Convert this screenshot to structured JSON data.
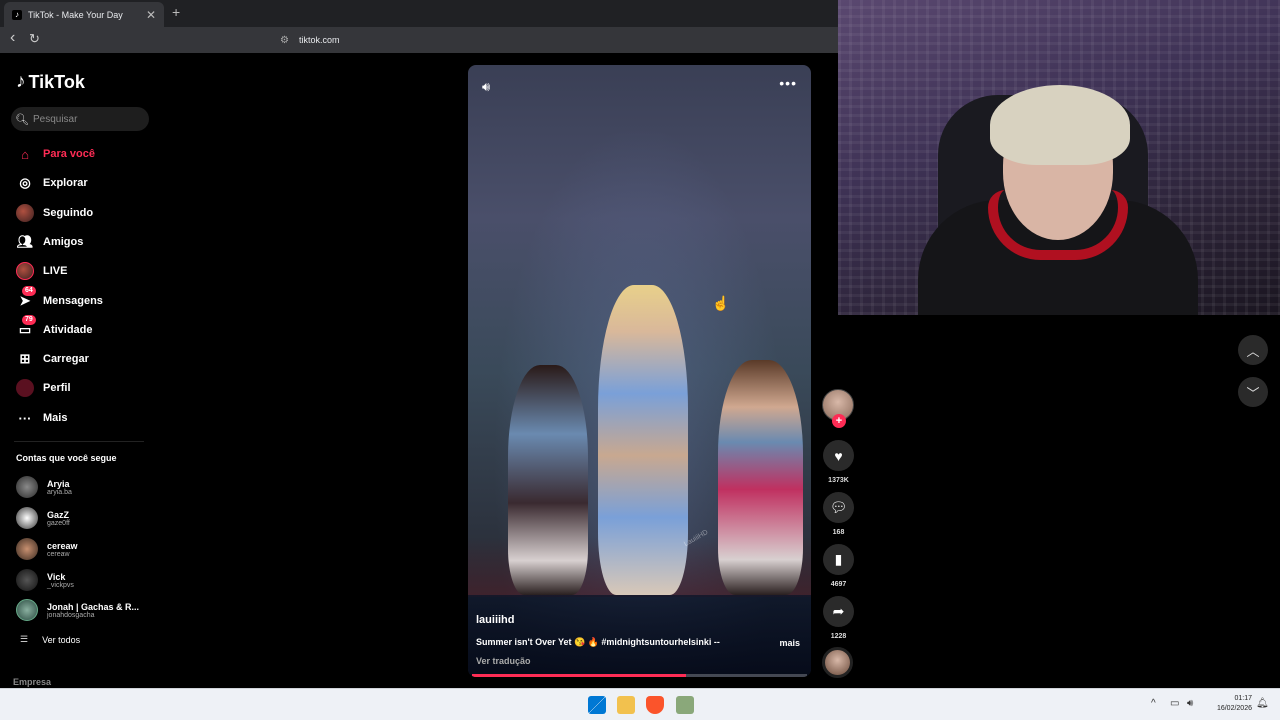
{
  "browser": {
    "tab_title": "TikTok - Make Your Day",
    "tab_close": "✕",
    "new_tab": "+",
    "back": "‹",
    "reload": "↻",
    "url": "tiktok.com"
  },
  "sidebar": {
    "logo": "TikTok",
    "search_placeholder": "Pesquisar",
    "nav": [
      {
        "label": "Para você",
        "icon": "home-icon",
        "active": true
      },
      {
        "label": "Explorar",
        "icon": "compass-icon"
      },
      {
        "label": "Seguindo",
        "icon": "following-avatar-icon"
      },
      {
        "label": "Amigos",
        "icon": "friends-icon"
      },
      {
        "label": "LIVE",
        "icon": "live-avatar-icon"
      },
      {
        "label": "Mensagens",
        "icon": "messages-icon",
        "badge": "64"
      },
      {
        "label": "Atividade",
        "icon": "activity-icon",
        "badge": "79"
      },
      {
        "label": "Carregar",
        "icon": "upload-icon"
      },
      {
        "label": "Perfil",
        "icon": "profile-avatar-icon"
      },
      {
        "label": "Mais",
        "icon": "more-dots-icon"
      }
    ],
    "following_title": "Contas que você segue",
    "accounts": [
      {
        "name": "Aryia",
        "handle": "aryia.ba"
      },
      {
        "name": "GazZ",
        "handle": "gaze0ff"
      },
      {
        "name": "cereaw",
        "handle": "cereaw"
      },
      {
        "name": "Vick",
        "handle": "_vickpvs"
      },
      {
        "name": "Jonah | Gachas & R...",
        "handle": "jonahdosgacha"
      }
    ],
    "see_all": "Ver todos",
    "footer": "Empresa"
  },
  "video": {
    "author": "lauiiihd",
    "caption": "Summer isn't Over Yet 😘 🔥 #midnightsuntourhelsinki --",
    "caption_more": "mais",
    "translate": "Ver tradução",
    "watermark": "LauiiiHD",
    "progress": 0.64
  },
  "actions": {
    "likes": "1373K",
    "comments": "168",
    "saves": "4697",
    "shares": "1228"
  },
  "taskbar": {
    "time": "01:17",
    "date": "16/02/2026"
  },
  "colors": {
    "accent": "#fe2c55",
    "sidebar_bg": "#000000",
    "chrome_bg": "#35363a"
  }
}
